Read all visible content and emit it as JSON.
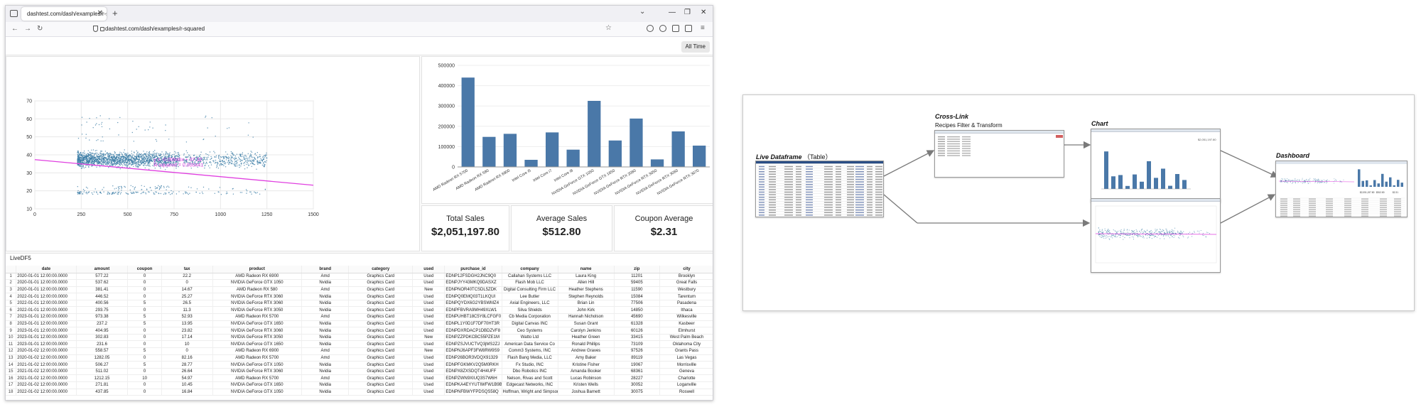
{
  "browser": {
    "tab_title": "dashtest.com/dash/examples/r-sq...",
    "url": "dashtest.com/dash/examples/r-squared",
    "time_filter": "All Time"
  },
  "scatter": {
    "equation": "y = -0.00946x + 37.32",
    "r_squared": "R-squared = 0.000441",
    "x_ticks": [
      "0",
      "250",
      "500",
      "750",
      "1000",
      "1250",
      "1500"
    ],
    "y_ticks": [
      "10",
      "20",
      "30",
      "40",
      "50",
      "60",
      "70"
    ],
    "point_color": "#3a7ca5",
    "line_color": "#e040e0"
  },
  "chart_data": {
    "type": "bar",
    "categories": [
      "AMD Radeon RX 5700",
      "AMD Radeon RX 580",
      "AMD Radeon RX 6900",
      "Intel Core i5",
      "Intel Core i7",
      "Intel Core i9",
      "NVIDIA GeForce GTX 1050",
      "NVIDIA GeForce GTX 1650",
      "NVIDIA GeForce RTX 2060",
      "NVIDIA GeForce RTX 3050",
      "NVIDIA GeForce RTX 3060",
      "NVIDIA GeForce RTX 3070"
    ],
    "values": [
      440000,
      148000,
      163000,
      35000,
      170000,
      85000,
      325000,
      130000,
      238000,
      37000,
      175000,
      105000
    ],
    "y_ticks": [
      "0",
      "100000",
      "200000",
      "300000",
      "400000",
      "500000"
    ],
    "ylim": [
      0,
      500000
    ],
    "bar_color": "#4a78a8"
  },
  "kpis": [
    {
      "title": "Total Sales",
      "value": "$2,051,197.80"
    },
    {
      "title": "Average Sales",
      "value": "$512.80"
    },
    {
      "title": "Coupon Average",
      "value": "$2.31"
    }
  ],
  "table": {
    "title": "LiveDF5",
    "columns": [
      "",
      "date",
      "amount",
      "coupon",
      "tax",
      "product",
      "brand",
      "category",
      "used",
      "purchase_id",
      "company",
      "name",
      "zip",
      "city"
    ],
    "rows": [
      [
        "1",
        "2020-01-01 12:00:00.0000",
        "577.22",
        "0",
        "22.2",
        "AMD Radeon RX 6900",
        "Amd",
        "Graphics Card",
        "Used",
        "EDNP12FSDGH2JNC9Q0",
        "Callahan Systems LLC",
        "Laura King",
        "11201",
        "Brooklyn"
      ],
      [
        "2",
        "2020-01-01 12:00:00.0000",
        "537.62",
        "0",
        "0",
        "NVIDIA GeForce GTX 1050",
        "Nvidia",
        "Graphics Card",
        "Used",
        "EDNPJYY43MKQ9DASXZ",
        "Flash Mob LLC",
        "Allen Hill",
        "59405",
        "Great Falls"
      ],
      [
        "3",
        "2020-01-01 12:00:00.0000",
        "381.41",
        "0",
        "14.67",
        "AMD Radeon RX 580",
        "Amd",
        "Graphics Card",
        "New",
        "EDNPNOR40TCSDL5ZDK",
        "Digital Consulting Firm LLC",
        "Heather Stephens",
        "11590",
        "Westbury"
      ],
      [
        "4",
        "2022-01-01 12:00:00.0000",
        "446.52",
        "0",
        "25.27",
        "NVIDIA GeForce RTX 3060",
        "Nvidia",
        "Graphics Card",
        "Used",
        "EDNPQ0EMQ03T1LKQUI",
        "Lee Butler",
        "Stephen Reynolds",
        "15084",
        "Tarentum"
      ],
      [
        "5",
        "2022-01-01 12:00:00.0000",
        "400.56",
        "5",
        "26.5",
        "NVIDIA GeForce RTX 3060",
        "Nvidia",
        "Graphics Card",
        "Used",
        "EDNPQYDX6G2YBSWMZ4",
        "Axial Engineers, LLC",
        "Brian Lin",
        "77506",
        "Pasadena"
      ],
      [
        "6",
        "2022-01-01 12:00:00.0000",
        "293.75",
        "0",
        "11.3",
        "NVIDIA GeForce RTX 3050",
        "Nvidia",
        "Graphics Card",
        "Used",
        "EDNPFBVRA9MH49XLW1",
        "Silva Shields",
        "John Kirk",
        "14850",
        "Ithaca"
      ],
      [
        "7",
        "2023-01-01 12:00:00.0000",
        "973.38",
        "5",
        "52.93",
        "AMD Radeon RX 5700",
        "Amd",
        "Graphics Card",
        "Used",
        "EDNPUHBT18C5Y8LCFGF0",
        "Cb Media Corporation",
        "Hannah Nicholson",
        "45690",
        "Wilkesville"
      ],
      [
        "8",
        "2023-01-01 12:00:00.0000",
        "237.2",
        "5",
        "13.95",
        "NVIDIA GeForce GTX 1650",
        "Nvidia",
        "Graphics Card",
        "Used",
        "EDNPL1Y0D1F7DF70HT3R",
        "Digital Canvas INC",
        "Susan Grant",
        "61328",
        "Kasbeer"
      ],
      [
        "9",
        "2023-01-01 12:00:00.0000",
        "404.95",
        "0",
        "23.82",
        "NVIDIA GeForce RTX 3060",
        "Nvidia",
        "Graphics Card",
        "Used",
        "EDNPDXRDACP1DBDZVF8",
        "Ceo Systems",
        "Carolyn Jenkins",
        "60126",
        "Elmhurst"
      ],
      [
        "10",
        "2023-01-01 12:00:00.0000",
        "302.83",
        "0",
        "17.14",
        "NVIDIA GeForce RTX 3050",
        "Nvidia",
        "Graphics Card",
        "New",
        "EDNPZZPDKCBC55PZE1M",
        "Watto Ltd",
        "Heather Green",
        "33415",
        "West Palm Beach"
      ],
      [
        "11",
        "2023-01-01 12:00:00.0000",
        "231.6",
        "0",
        "10",
        "NVIDIA GeForce GTX 1650",
        "Nvidia",
        "Graphics Card",
        "Used",
        "EDNPZSJVUCTVQ3jMS2ZJ",
        "American Data Service Co",
        "Ronald Phillips",
        "73109",
        "Oklahoma City"
      ],
      [
        "12",
        "2020-01-02 12:00:00.0000",
        "558.57",
        "5",
        "0",
        "AMD Radeon RX 6900",
        "Amd",
        "Graphics Card",
        "New",
        "EDNPNJ6APF3FW8RW9S9",
        "Comm3 Systems, INC",
        "Andrew Graves",
        "97526",
        "Grants Pass"
      ],
      [
        "13",
        "2020-01-02 12:00:00.0000",
        "1282.05",
        "0",
        "82.16",
        "AMD Radeon RX 5700",
        "Amd",
        "Graphics Card",
        "Used",
        "EDNP26BOR3VDQX91329",
        "Flash Bang Media, LLC",
        "Amy Baker",
        "89119",
        "Las Vegas"
      ],
      [
        "14",
        "2021-01-02 12:00:00.0000",
        "506.27",
        "5",
        "28.77",
        "NVIDIA GeForce GTX 1050",
        "Nvidia",
        "Graphics Card",
        "Used",
        "EDNPFGKMKV2Q5M0RKH",
        "Fx Studio, INC",
        "Kristine Fisher",
        "19067",
        "Morrisville"
      ],
      [
        "15",
        "2021-01-02 12:00:00.0000",
        "511.02",
        "0",
        "26.64",
        "NVIDIA GeForce RTX 3060",
        "Nvidia",
        "Graphics Card",
        "Used",
        "EDNPX8ZXSDQT4H4UFF",
        "Dbo Robotics INC",
        "Amanda Booker",
        "68361",
        "Geneva"
      ],
      [
        "16",
        "2021-01-02 12:00:00.0000",
        "1212.15",
        "10",
        "54.97",
        "AMD Radeon RX 5700",
        "Amd",
        "Graphics Card",
        "Used",
        "EDNPZWN9XIUQ3S7W6H",
        "Nelson, Rivas and Scott",
        "Lucas Robinson",
        "28227",
        "Charlotte"
      ],
      [
        "17",
        "2022-01-02 12:00:00.0000",
        "271.81",
        "0",
        "10.45",
        "NVIDIA GeForce GTX 1650",
        "Nvidia",
        "Graphics Card",
        "Used",
        "EDNPKA4EYYUTIWFW1B9B",
        "Edgecast Networks, INC",
        "Kristen Wells",
        "30052",
        "Loganville"
      ],
      [
        "18",
        "2022-01-02 12:00:00.0000",
        "437.85",
        "0",
        "16.84",
        "NVIDIA GeForce GTX 1050",
        "Nvidia",
        "Graphics Card",
        "Used",
        "EDNPNFBWYFPDSQS58Q",
        "Hoffman, Wright and Simpson",
        "Joshua Barnett",
        "30075",
        "Roswell"
      ]
    ]
  },
  "diagram": {
    "live_title": "Live Dataframe",
    "live_sub": "（Table）",
    "crosslink_title": "Cross-Link",
    "crosslink_sub": "Recipes Filter & Transform",
    "chart_title": "Chart",
    "dashboard_title": "Dashboard",
    "arrow_color": "#7a7a7a"
  }
}
